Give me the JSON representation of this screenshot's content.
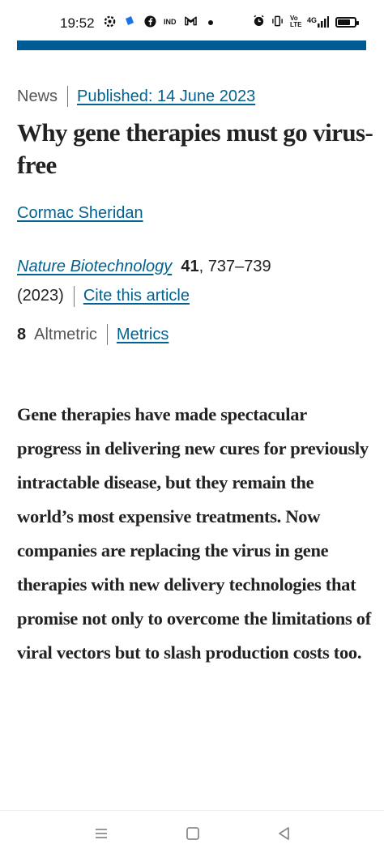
{
  "status_bar": {
    "time": "19:52",
    "left_icons": [
      "settings-icon",
      "app-icon",
      "facebook-icon",
      "ind-icon",
      "gmail-icon",
      "dot-icon"
    ],
    "right_icons": [
      "alarm-icon",
      "vibrate-icon",
      "volte-icon",
      "signal-4g-icon",
      "battery-icon"
    ],
    "volte_text": "Vo LTE",
    "network_text": "4G",
    "battery_level": 0.75
  },
  "article": {
    "type": "News",
    "published": "Published: 14 June 2023",
    "title": "Why gene therapies must go virus-free",
    "author": "Cormac Sheridan",
    "journal": "Nature Biotechnology",
    "volume": "41",
    "pages": ", 737–739",
    "year": "(2023)",
    "cite_link": "Cite this article",
    "altmetric_count": "8",
    "altmetric_label": "Altmetric",
    "metrics_link": "Metrics",
    "abstract": "Gene therapies have made spectacular progress in delivering new cures for previously intractable disease, but they remain the world’s most expensive treatments. Now companies are replacing the virus in gene therapies with new delivery technologies that promise not only to overcome the limitations of viral vectors but to slash production costs too."
  },
  "nav_bar": {
    "buttons": [
      "menu-icon",
      "home-icon",
      "back-icon"
    ]
  },
  "colors": {
    "brand_bar": "#005b94",
    "link": "#03618f",
    "text": "#222222"
  }
}
